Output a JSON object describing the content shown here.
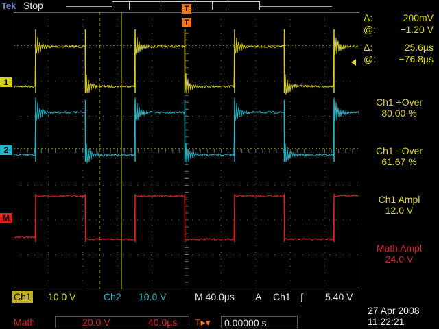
{
  "header": {
    "brand": "Tek",
    "status": "Stop"
  },
  "channels": {
    "ch1_marker": "1",
    "ch2_marker": "2",
    "math_marker": "M",
    "trigger_marker": "T"
  },
  "colors": {
    "ch1": "#d8d020",
    "ch2": "#20b8c8",
    "math": "#e02020",
    "cursor": "#d8d020",
    "grid": "#6a6a6a"
  },
  "cursor_readout": {
    "v_delta_symbol": "Δ:",
    "v_delta": "200mV",
    "v_at_symbol": "@:",
    "v_at": "−1.20 V",
    "t_delta_symbol": "Δ:",
    "t_delta": "25.6µs",
    "t_at_symbol": "@:",
    "t_at": "−76.8µs"
  },
  "measurements": [
    {
      "name": "Ch1 +Over",
      "value": "80.00 %",
      "color": "yellow"
    },
    {
      "name": "Ch1 −Over",
      "value": "61.67 %",
      "color": "yellow"
    },
    {
      "name": "Ch1 Ampl",
      "value": "12.0 V",
      "color": "yellow"
    },
    {
      "name": "Math Ampl",
      "value": "24.0 V",
      "color": "red"
    }
  ],
  "bottom": {
    "ch1_label": "Ch1",
    "ch1_scale": "10.0 V",
    "ch2_label": "Ch2",
    "ch2_scale": "10.0 V",
    "timebase": "M 40.0µs",
    "trig_mode": "A",
    "trig_source": "Ch1",
    "trig_slope": "∫",
    "trig_level": "5.40 V",
    "math_label": "Math",
    "math_scale": "20.0 V",
    "math_time": "40.0µs",
    "trig_pos_icon": "T▸▾",
    "trig_pos": "0.00000 s"
  },
  "datetime": {
    "date": "27 Apr 2008",
    "time": "11:22:21"
  }
}
